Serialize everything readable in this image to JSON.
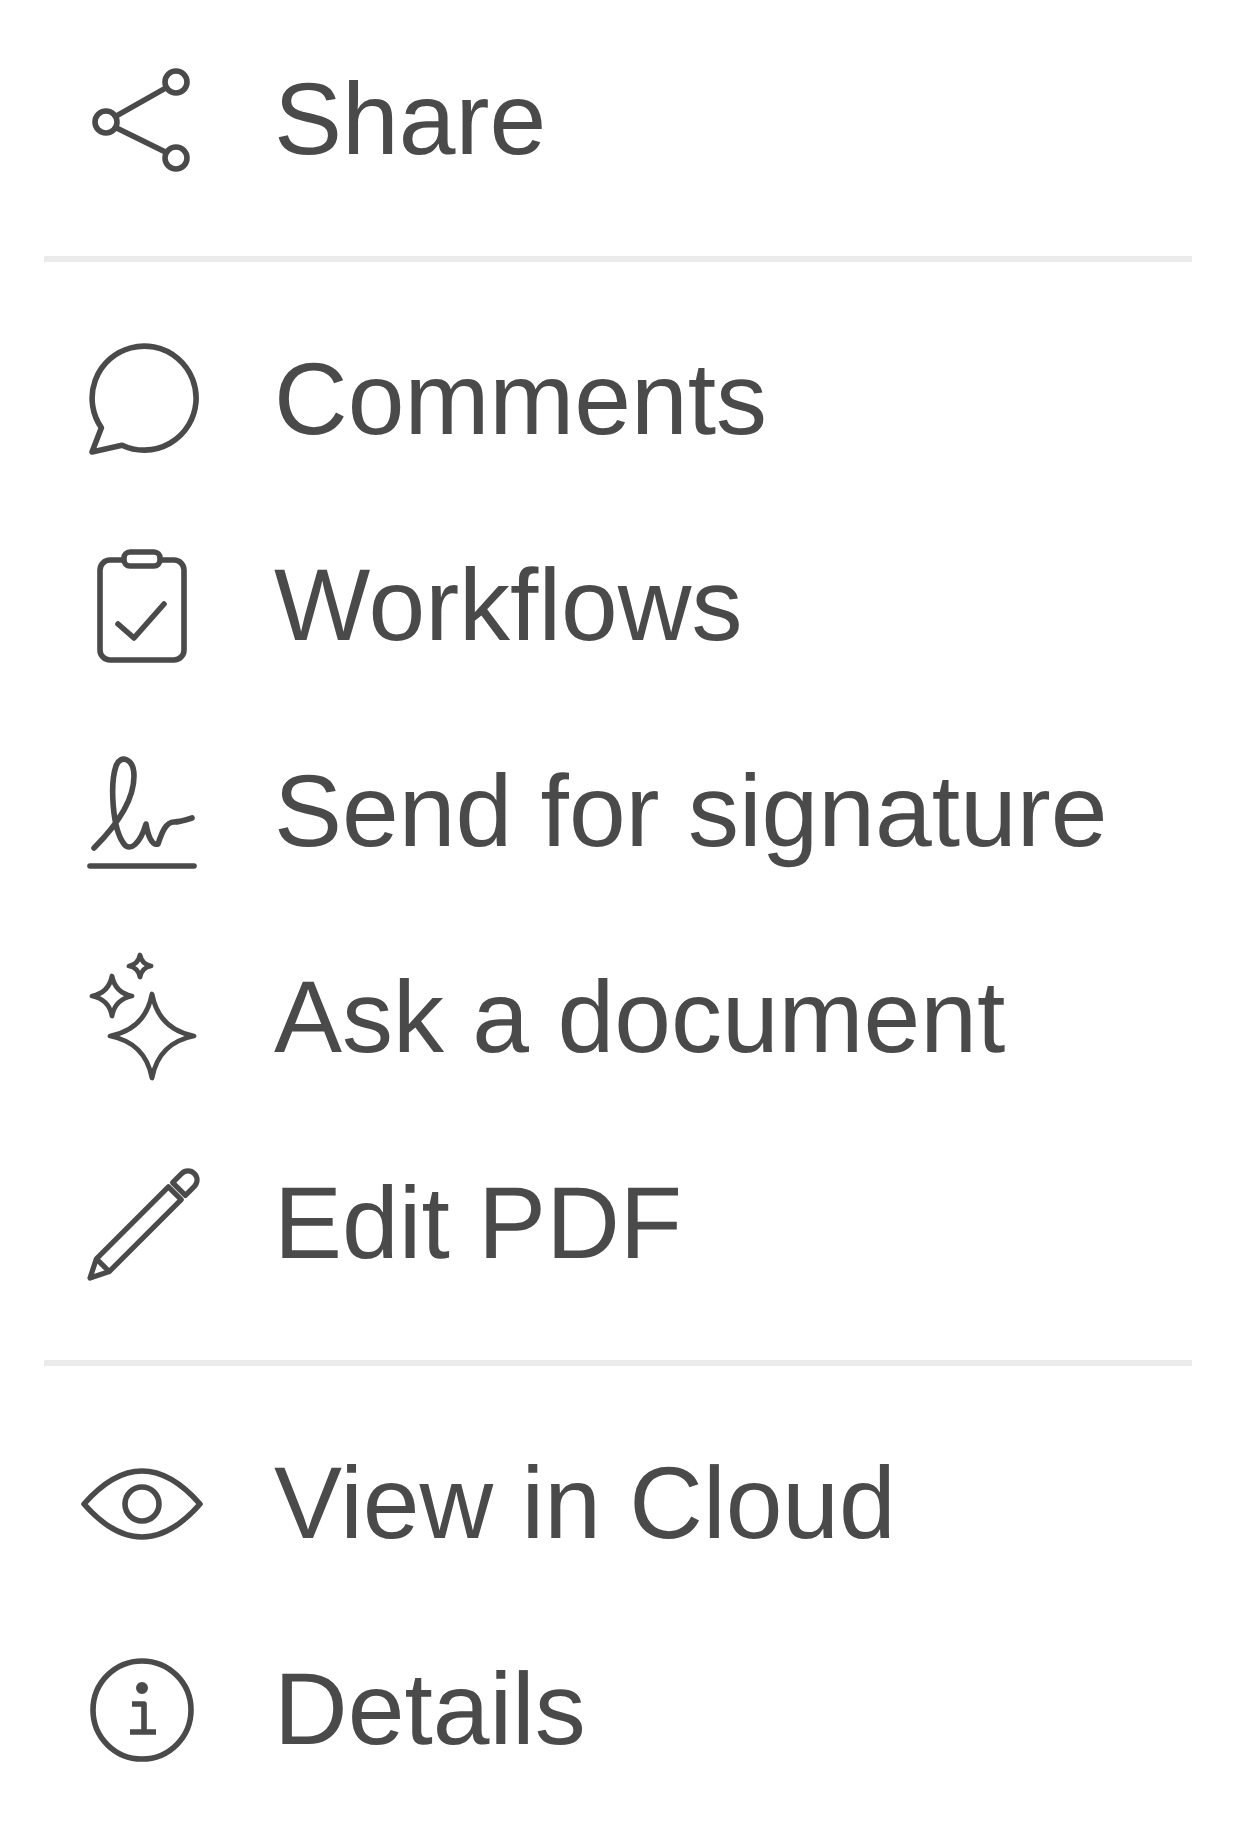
{
  "menu": {
    "sections": [
      {
        "items": [
          {
            "label": "Share"
          }
        ]
      },
      {
        "items": [
          {
            "label": "Comments"
          },
          {
            "label": "Workflows"
          },
          {
            "label": "Send for signature"
          },
          {
            "label": "Ask a document"
          },
          {
            "label": "Edit PDF"
          }
        ]
      },
      {
        "items": [
          {
            "label": "View in Cloud"
          },
          {
            "label": "Details"
          }
        ]
      }
    ]
  }
}
